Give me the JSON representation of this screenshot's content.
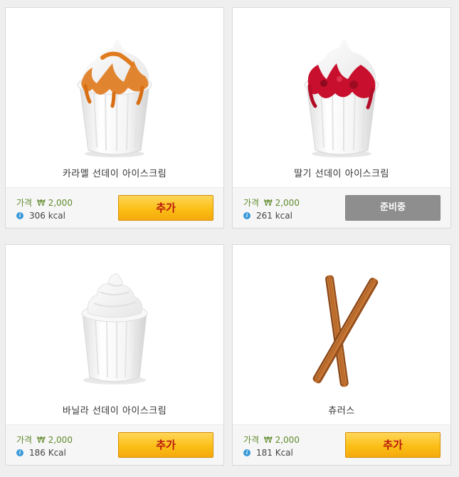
{
  "products": [
    {
      "name": "카라멜 선데이 아이스크림",
      "price_label": "가격",
      "price": "₩ 2,000",
      "calories": "306 kcal",
      "button_label": "추가",
      "button_state": "add",
      "image": "caramel-sundae-image",
      "topping_color": "#e07b1e"
    },
    {
      "name": "딸기 선데이 아이스크림",
      "price_label": "가격",
      "price": "₩ 2,000",
      "calories": "261 kcal",
      "button_label": "준비중",
      "button_state": "preparing",
      "image": "strawberry-sundae-image",
      "topping_color": "#c8102e"
    },
    {
      "name": "바닐라 선데이 아이스크림",
      "price_label": "가격",
      "price": "₩ 2,000",
      "calories": "186 Kcal",
      "button_label": "추가",
      "button_state": "add",
      "image": "vanilla-sundae-image"
    },
    {
      "name": "츄러스",
      "price_label": "가격",
      "price": "₩ 2,000",
      "calories": "181 Kcal",
      "button_label": "추가",
      "button_state": "add",
      "image": "churros-image",
      "topping_color": "#a0561c"
    }
  ],
  "colors": {
    "price_text": "#5f8a2c",
    "add_button_bg": "#fbbf16",
    "add_button_text": "#b9180f",
    "preparing_button_bg": "#8e8e8e",
    "info_icon": "#3a9ad9"
  },
  "icons": {
    "info": "info-icon"
  }
}
